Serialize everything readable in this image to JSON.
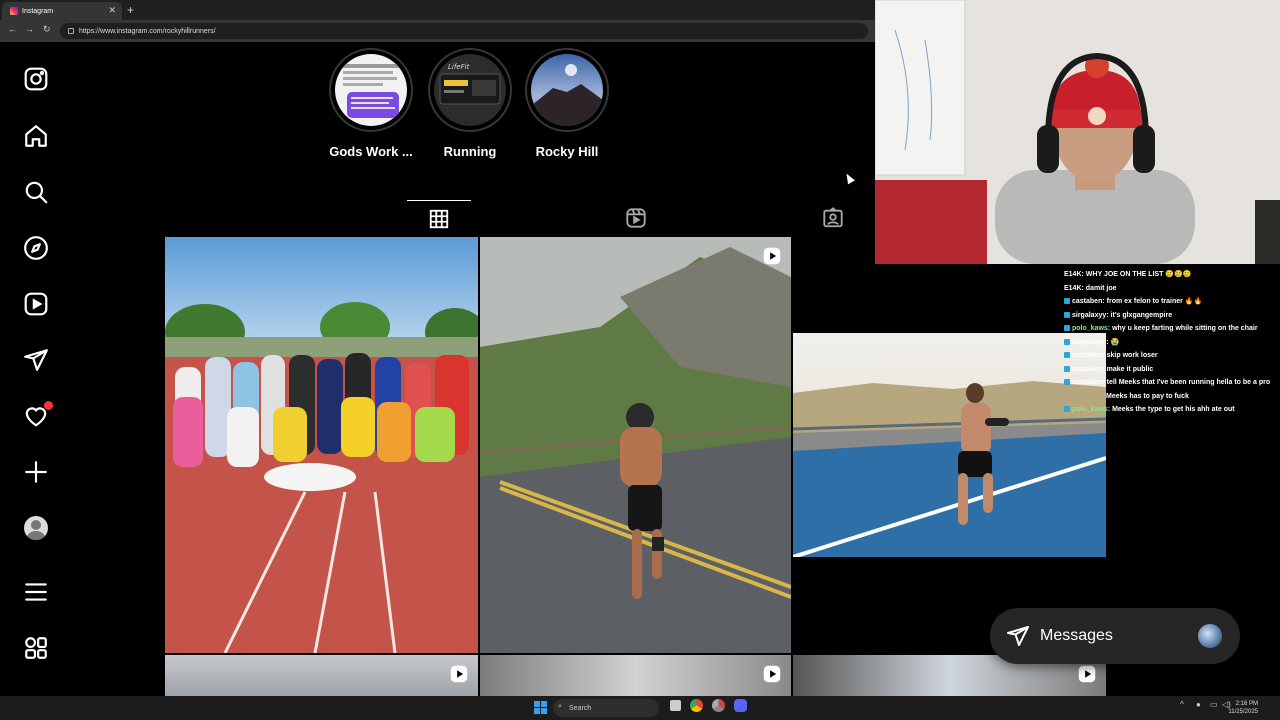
{
  "browser": {
    "tab_title": "Instagram",
    "url": "https://www.instagram.com/rockyhillrunners/"
  },
  "sidebar": {
    "items": [
      {
        "icon": "instagram-logo-icon"
      },
      {
        "icon": "home-icon"
      },
      {
        "icon": "search-icon"
      },
      {
        "icon": "explore-icon"
      },
      {
        "icon": "reels-icon"
      },
      {
        "icon": "messages-icon"
      },
      {
        "icon": "notifications-icon"
      },
      {
        "icon": "create-icon"
      },
      {
        "icon": "profile-icon"
      },
      {
        "icon": "more-menu-icon"
      },
      {
        "icon": "also-from-meta-icon"
      }
    ]
  },
  "highlights": [
    {
      "label": "Gods Work ..."
    },
    {
      "label": "Running"
    },
    {
      "label": "Rocky Hill"
    }
  ],
  "profile_tabs": [
    {
      "icon": "grid-icon",
      "active": true
    },
    {
      "icon": "reels-tab-icon",
      "active": false
    },
    {
      "icon": "tagged-icon",
      "active": false
    }
  ],
  "chat": [
    {
      "user": "E14K:",
      "text": "WHY JOE ON THE LIST 🥲🥲🥲",
      "green": false
    },
    {
      "user": "E14K:",
      "text": "damit joe",
      "green": false
    },
    {
      "user": "castaben:",
      "text": "from ex felon to trainer 🔥🔥",
      "green": false
    },
    {
      "user": "sirgalaxyy:",
      "text": "it's glxgangempire",
      "green": false
    },
    {
      "user": "polo_kaws:",
      "text": "why u keep farting while sitting on the chair",
      "green": true
    },
    {
      "user": "sirgalaxyy:",
      "text": "😭",
      "green": false
    },
    {
      "user": "castaben:",
      "text": "skip work loser",
      "green": false
    },
    {
      "user": "castaben:",
      "text": "make it public",
      "green": false
    },
    {
      "user": "castaben:",
      "text": "tell Meeks that I've been running hella to be a pro",
      "green": false
    },
    {
      "user": "",
      "text": "Meeks has to pay to fuck",
      "green": false
    },
    {
      "user": "polo_kaws:",
      "text": "Meeks the type to get his ahh ate out",
      "green": true
    }
  ],
  "messages": {
    "label": "Messages"
  },
  "taskbar": {
    "search": "Search",
    "time": "2:16 PM",
    "date": "11/25/2025"
  }
}
